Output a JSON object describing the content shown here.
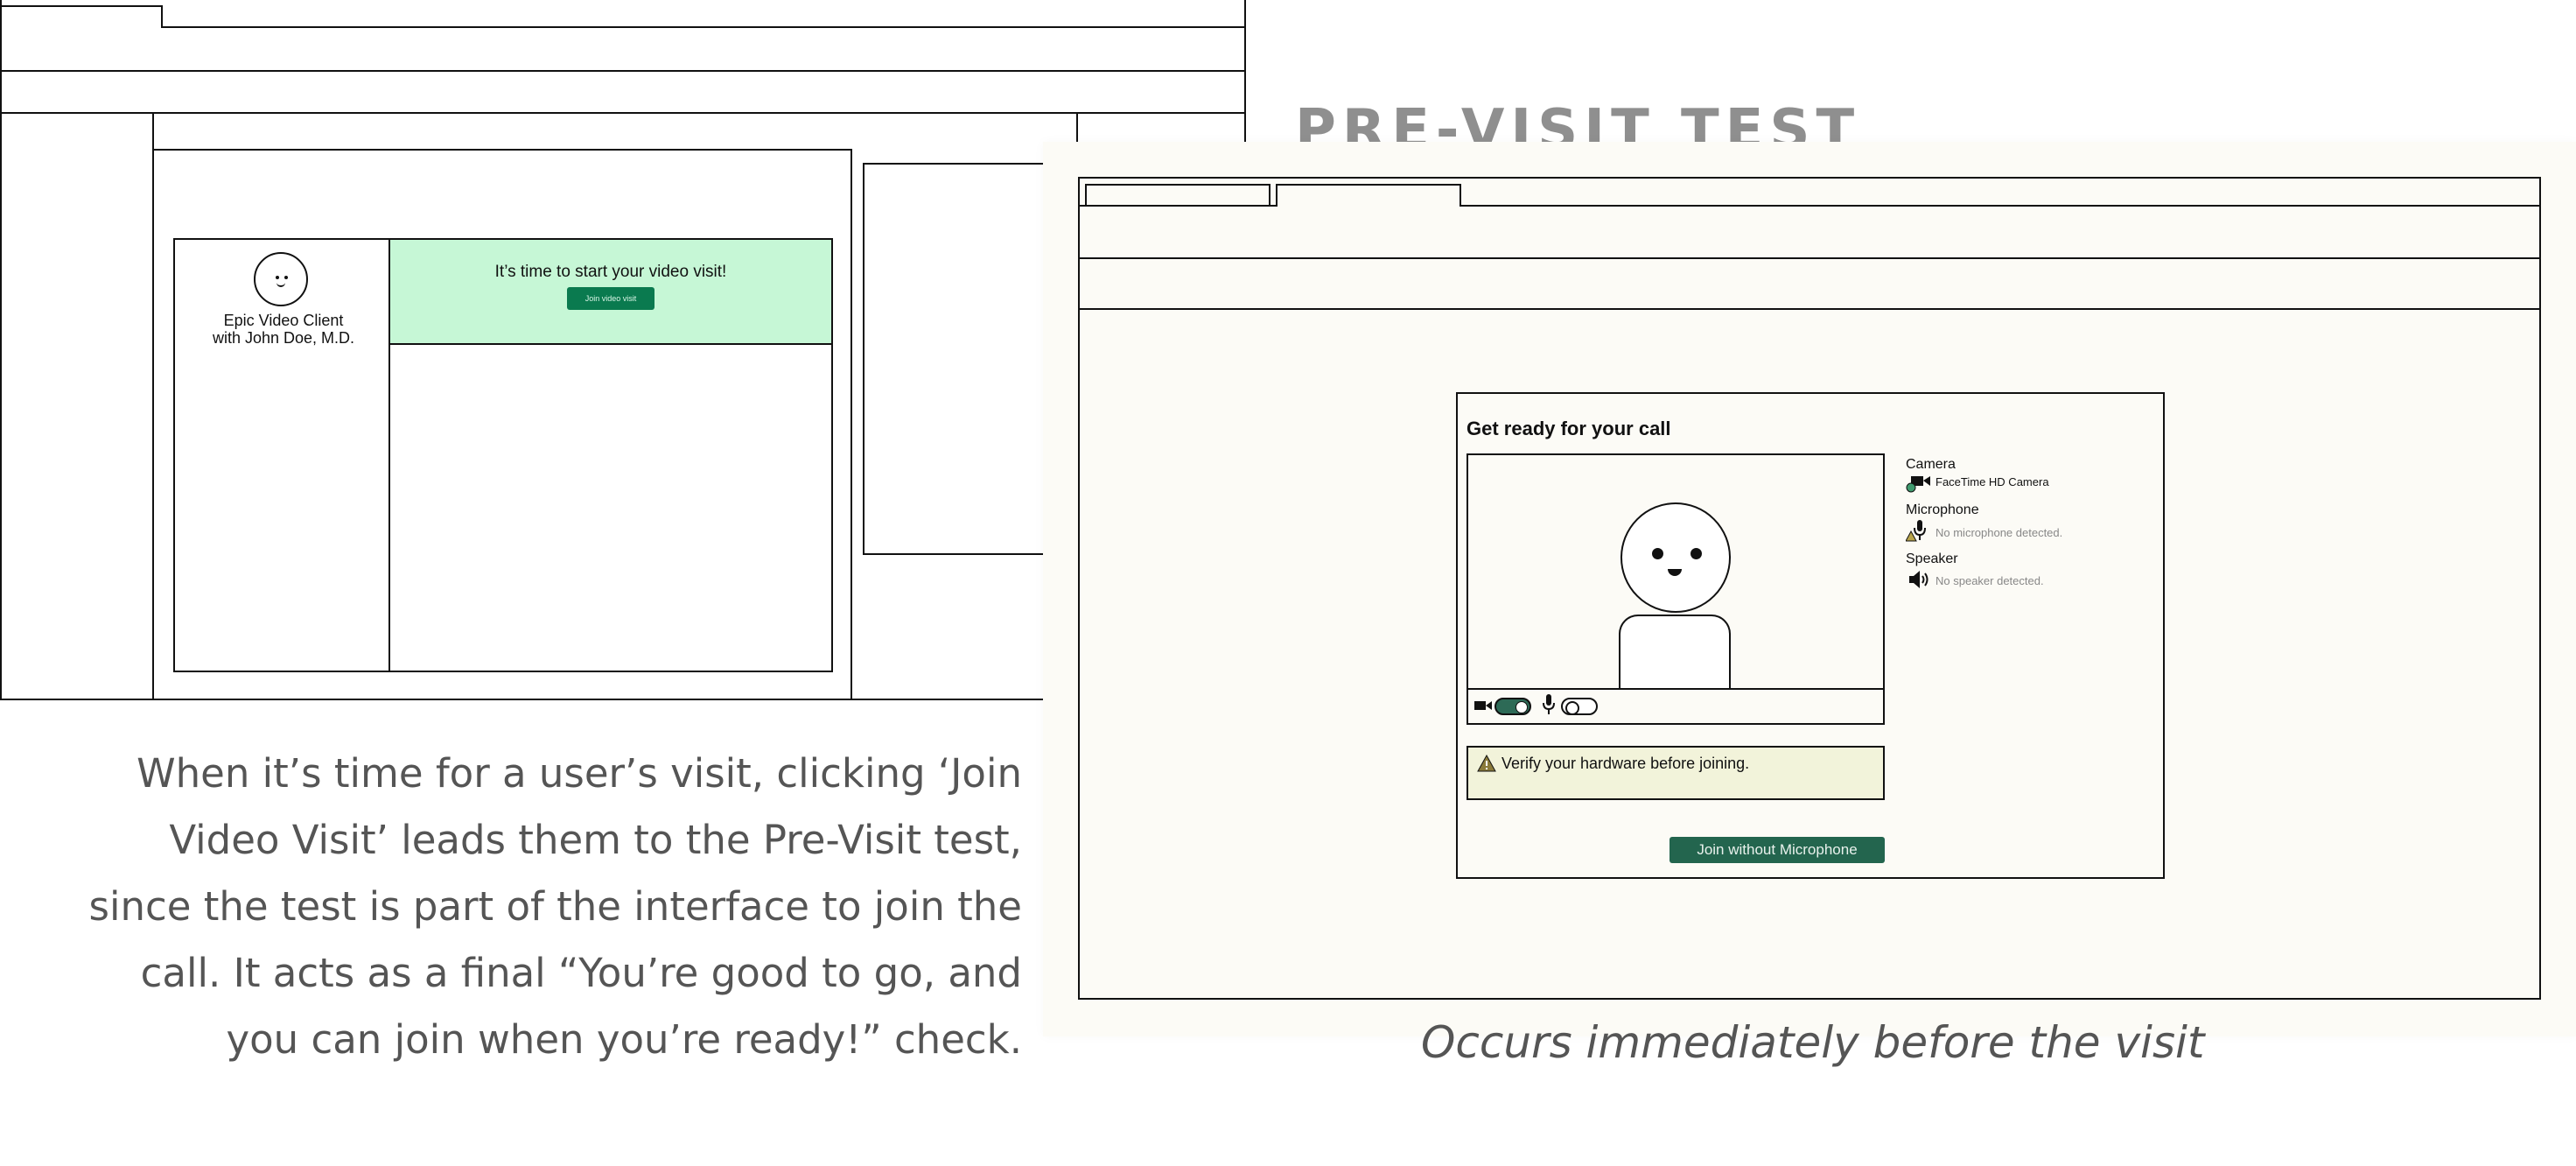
{
  "left_wireframe": {
    "client_name_line1": "Epic Video Client",
    "client_name_line2": "with John Doe, M.D.",
    "banner_title": "It’s time to start your video visit!",
    "join_button_label": "Join video visit",
    "banner_color": "#c6f7d6",
    "button_color": "#0a7a4f"
  },
  "heading": "PRE-VISIT TEST",
  "pre_visit_test": {
    "title": "Get ready for your call",
    "camera_toggle_on": true,
    "microphone_toggle_on": false,
    "devices": {
      "camera_label": "Camera",
      "camera_value": "FaceTime HD Camera",
      "microphone_label": "Microphone",
      "microphone_value": "No microphone detected.",
      "speaker_label": "Speaker",
      "speaker_value": "No speaker detected."
    },
    "warning_text": "Verify your hardware before joining.",
    "join_button_label": "Join without Microphone",
    "button_color": "#23654e",
    "panel_background": "#fcfbf6",
    "warning_background": "#f2f3da"
  },
  "description_lines": [
    "When it’s time for a user’s visit, clicking ‘Join",
    "Video Visit’ leads them to the Pre-Visit test,",
    "since the test is part of the interface to join the",
    "call. It acts as a final “You’re good to go, and",
    "you can join when you’re ready!” check."
  ],
  "caption": "Occurs immediately before the visit"
}
